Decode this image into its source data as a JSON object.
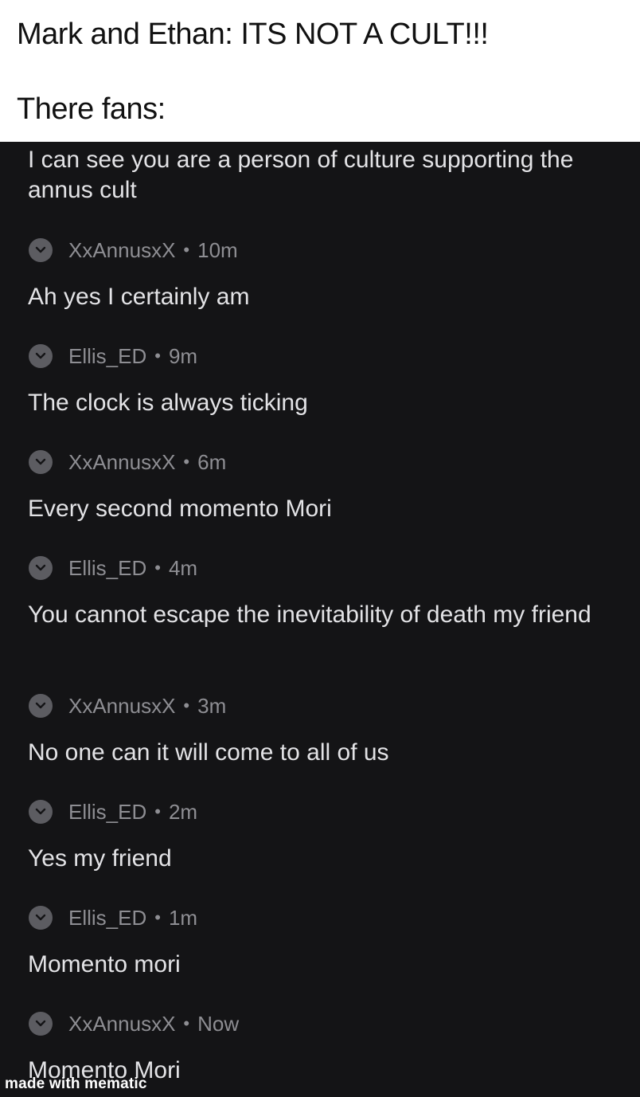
{
  "caption": {
    "line1": "Mark and Ethan: ITS NOT A CULT!!!",
    "line2": "There fans:"
  },
  "thread": {
    "top_text": "I can see you are a person of culture supporting the annus cult",
    "separator": "•",
    "comments": [
      {
        "author": "XxAnnusxX",
        "time": "10m",
        "text": "Ah yes I certainly am"
      },
      {
        "author": "Ellis_ED",
        "time": "9m",
        "text": "The clock is always ticking"
      },
      {
        "author": "XxAnnusxX",
        "time": "6m",
        "text": "Every second momento Mori"
      },
      {
        "author": "Ellis_ED",
        "time": "4m",
        "text": "You cannot escape the inevitability of death my friend"
      },
      {
        "author": "XxAnnusxX",
        "time": "3m",
        "text": "No one can it will come to all of us"
      },
      {
        "author": "Ellis_ED",
        "time": "2m",
        "text": "Yes my friend"
      },
      {
        "author": "Ellis_ED",
        "time": "1m",
        "text": "Momento mori"
      },
      {
        "author": "XxAnnusxX",
        "time": "Now",
        "text": "Momento Mori"
      }
    ]
  },
  "watermark": "made with mematic",
  "colors": {
    "background": "#141416",
    "text": "#e3e3e6",
    "meta": "#8e8e93",
    "collapse_button": "#5c5c61"
  },
  "icons": {
    "collapse": "chevron-down-icon"
  }
}
